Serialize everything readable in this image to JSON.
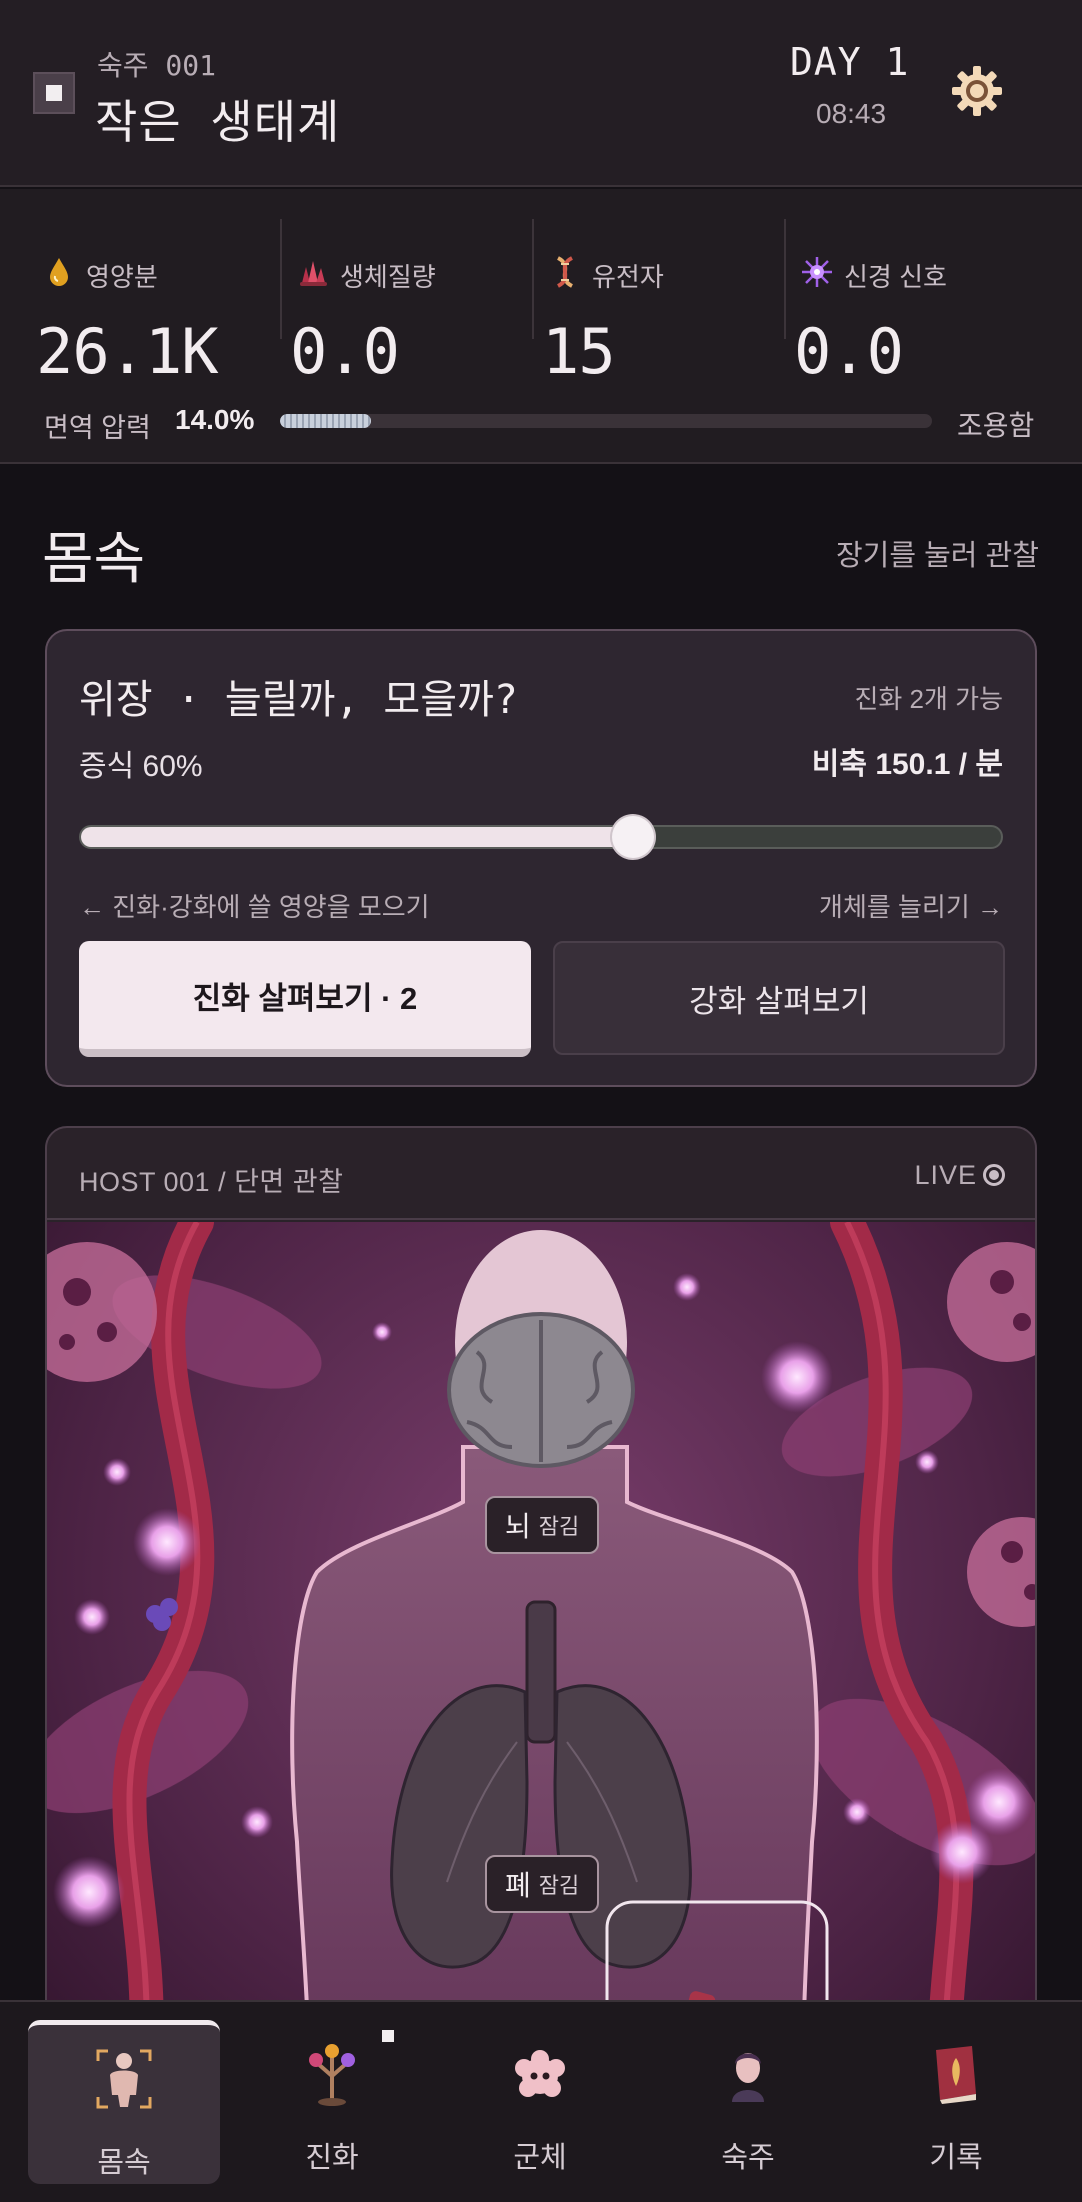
{
  "header": {
    "host_id": "숙주 001",
    "title": "작은 생태계",
    "day": "DAY 1",
    "time": "08:43",
    "settings_icon": "gear-icon"
  },
  "resources": [
    {
      "icon": "drop-icon",
      "label": "영양분",
      "value": "26.1K",
      "color": "#e0a020"
    },
    {
      "icon": "crystal-icon",
      "label": "생체질량",
      "value": "0.0",
      "color": "#d8485e"
    },
    {
      "icon": "dna-icon",
      "label": "유전자",
      "value": "15",
      "color": "#e8b070"
    },
    {
      "icon": "neuron-icon",
      "label": "신경 신호",
      "value": "0.0",
      "color": "#a060e8"
    }
  ],
  "immune": {
    "label": "면역 압력",
    "value": "14.0%",
    "level": 0.14,
    "status": "조용함"
  },
  "section": {
    "title": "몸속",
    "hint": "장기를 눌러 관찰"
  },
  "decision": {
    "title": "위장 · 늘릴까, 모을까?",
    "evolutions": "진화 2개 가능",
    "left_text": "증식 60%",
    "right_text": "비축 150.1 / 분",
    "slider_value": 0.6,
    "hint_left": "← 진화·강화에 쓸 영양을 모으기",
    "hint_right": "개체를 늘리기 →",
    "primary_button": "진화 살펴보기 · 2",
    "secondary_button": "강화 살펴보기"
  },
  "observation": {
    "title": "HOST 001 / 단면 관찰",
    "live_label": "LIVE",
    "organs": [
      {
        "name": "뇌",
        "state": "잠김"
      },
      {
        "name": "폐",
        "state": "잠김"
      }
    ]
  },
  "nav": [
    {
      "label": "몸속",
      "icon": "body-icon",
      "active": true
    },
    {
      "label": "진화",
      "icon": "evolution-tree-icon",
      "active": false
    },
    {
      "label": "군체",
      "icon": "colony-icon",
      "active": false
    },
    {
      "label": "숙주",
      "icon": "host-person-icon",
      "active": false
    },
    {
      "label": "기록",
      "icon": "book-icon",
      "active": false
    }
  ]
}
